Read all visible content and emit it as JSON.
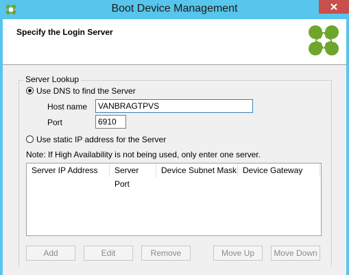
{
  "window": {
    "title": "Boot Device Management"
  },
  "header": {
    "title": "Specify the Login Server"
  },
  "icons": {
    "app": "citrix-logo-icon",
    "close": "close-icon",
    "logo": "citrix-logo-icon"
  },
  "colors": {
    "titlebar": "#57c5ec",
    "close": "#c7504d",
    "logo_green": "#6ea52c",
    "focus_border": "#3c7fb1"
  },
  "server_lookup": {
    "group_label": "Server Lookup",
    "dns_option": {
      "label": "Use DNS to find the Server",
      "selected": true
    },
    "host_name": {
      "label": "Host name",
      "value": "VANBRAGTPVS"
    },
    "port": {
      "label": "Port",
      "value": "6910"
    },
    "static_option": {
      "label": "Use static IP address for the Server",
      "selected": false
    },
    "note": "Note: If High Availability is not being used, only enter one server."
  },
  "server_table": {
    "columns": [
      "Server IP Address",
      "Server Port",
      "Device Subnet Mask",
      "Device Gateway"
    ],
    "rows": []
  },
  "buttons": {
    "add": "Add",
    "edit": "Edit",
    "remove": "Remove",
    "move_up": "Move Up",
    "move_down": "Move Down"
  }
}
